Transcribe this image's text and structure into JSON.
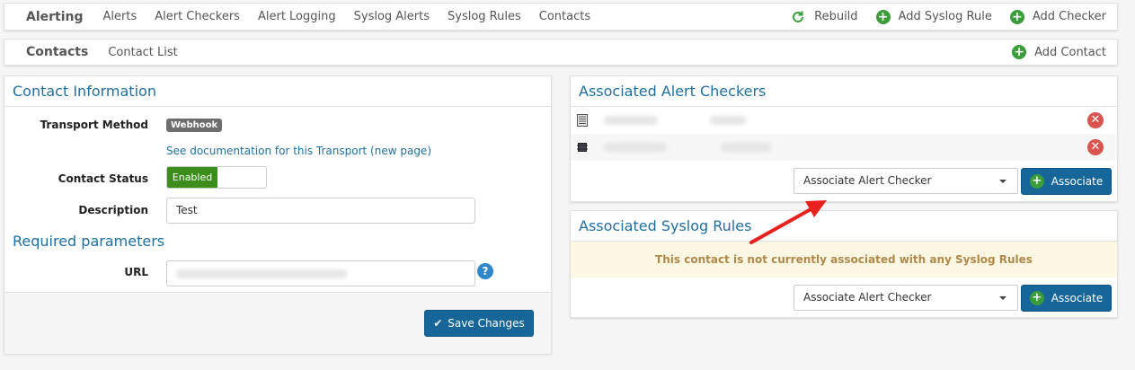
{
  "nav": {
    "brand": "Alerting",
    "links": [
      "Alerts",
      "Alert Checkers",
      "Alert Logging",
      "Syslog Alerts",
      "Syslog Rules",
      "Contacts"
    ],
    "actions": {
      "rebuild": "Rebuild",
      "add_syslog_rule": "Add Syslog Rule",
      "add_checker": "Add Checker"
    }
  },
  "subnav": {
    "title": "Contacts",
    "link": "Contact List",
    "add_contact": "Add Contact"
  },
  "contact_info": {
    "title": "Contact Information",
    "transport_label": "Transport Method",
    "transport_value": "Webhook",
    "doc_link": "See documentation for this Transport (new page)",
    "status_label": "Contact Status",
    "status_value": "Enabled",
    "description_label": "Description",
    "description_value": "Test",
    "required_title": "Required parameters",
    "url_label": "URL",
    "help_icon": "?",
    "save_label": "Save Changes"
  },
  "alert_checkers": {
    "title": "Associated Alert Checkers",
    "select_value": "Associate Alert Checker",
    "button": "Associate"
  },
  "syslog_rules": {
    "title": "Associated Syslog Rules",
    "empty_message": "This contact is not currently associated with any Syslog Rules",
    "select_value": "Associate Alert Checker",
    "button": "Associate"
  },
  "colors": {
    "accent": "#1f6fa0",
    "success": "#3a9d3a",
    "danger": "#d9534f",
    "warning_bg": "#fcf8e3",
    "arrow": "#e8201e"
  }
}
